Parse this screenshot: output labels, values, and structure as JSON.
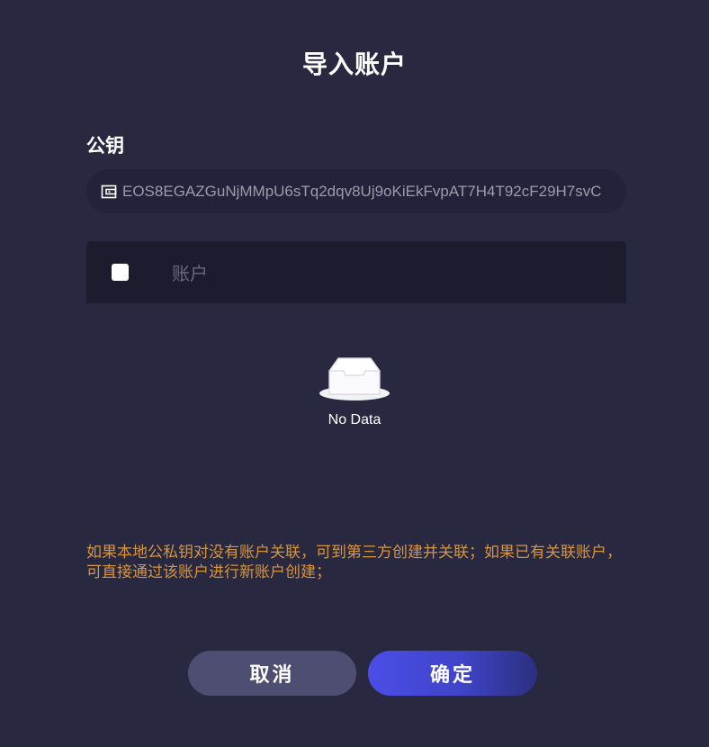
{
  "dialog": {
    "title": "导入账户"
  },
  "public_key": {
    "label": "公钥",
    "icon": "wallet-icon",
    "value": "EOS8EGAZGuNjMMpU6sTq2dqv8Uj9oKiEkFvpAT7H4T92cF29H7svC"
  },
  "accounts_table": {
    "columns": [
      "账户"
    ],
    "select_all_checked": false,
    "rows": [],
    "empty_icon": "empty-inbox-icon",
    "empty_text": "No Data"
  },
  "notice": {
    "text": "如果本地公私钥对没有账户关联，可到第三方创建并关联；如果已有关联账户，可直接通过该账户进行新账户创建；",
    "color": "#d9953b"
  },
  "actions": {
    "cancel_label": "取消",
    "confirm_label": "确定"
  },
  "colors": {
    "background": "#282840",
    "input_background": "#22223a",
    "table_header": "#1c1c2e",
    "cancel_button": "#4e4e72",
    "confirm_button": "#4b4ee6"
  }
}
